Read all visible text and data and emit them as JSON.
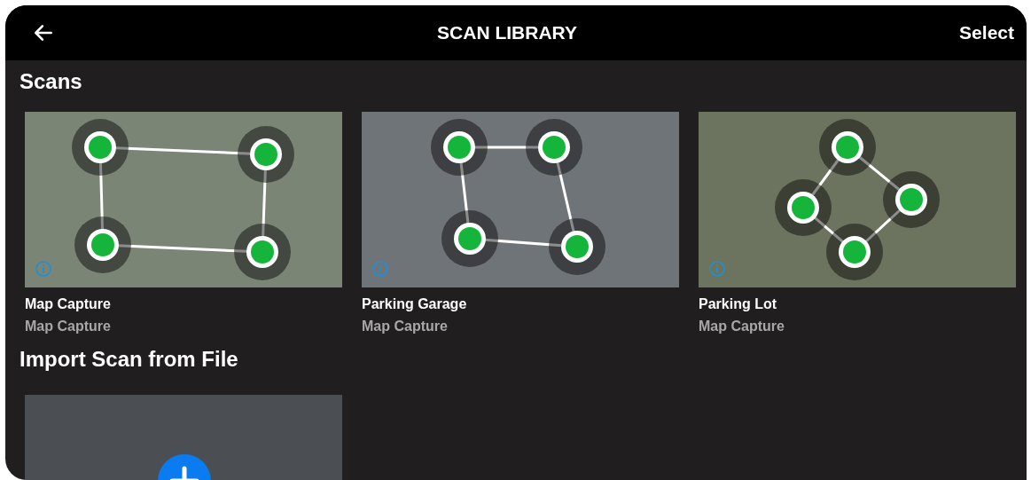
{
  "header": {
    "title": "SCAN LIBRARY",
    "action": "Select"
  },
  "scans_section": {
    "title": "Scans",
    "items": [
      {
        "title": "Map Capture",
        "subtitle": "Map Capture"
      },
      {
        "title": "Parking Garage",
        "subtitle": "Map Capture"
      },
      {
        "title": "Parking Lot",
        "subtitle": "Map Capture"
      }
    ]
  },
  "import_section": {
    "title": "Import Scan from File"
  }
}
